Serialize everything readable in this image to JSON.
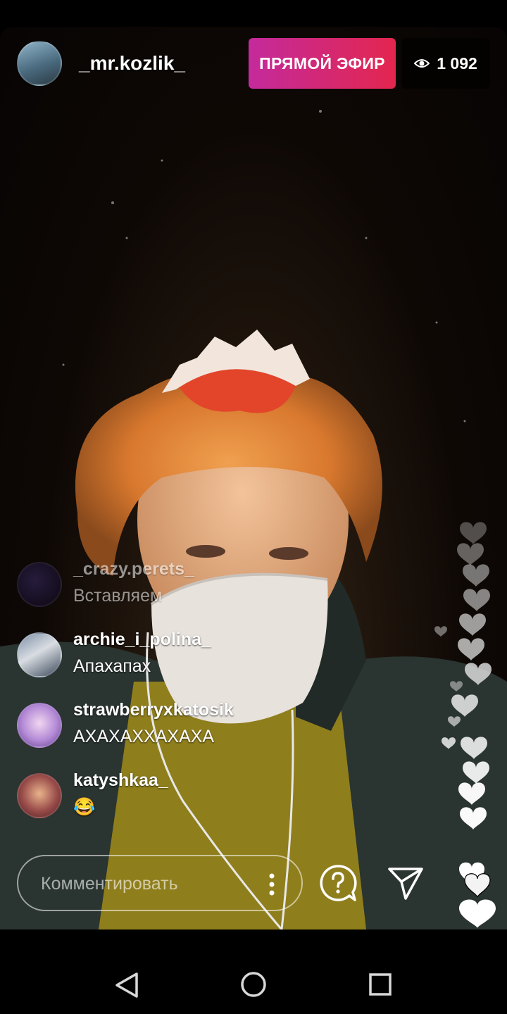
{
  "stream": {
    "host_username": "_mr.kozlik_",
    "live_label": "ПРЯМОЙ ЭФИР",
    "viewer_count": "1 092",
    "viewer_icon": "eye-icon"
  },
  "comments": [
    {
      "username": "_crazy.perets_",
      "text": "Вставляем"
    },
    {
      "username": "archie_i_polina_",
      "text": "Апахапах"
    },
    {
      "username": "strawberryxkatosik",
      "text": "АХАХАХХАХАХА"
    },
    {
      "username": "katyshkaa_",
      "text": "😂"
    }
  ],
  "composer": {
    "placeholder": "Комментировать",
    "more_icon": "vertical-dots-icon",
    "question_icon": "question-bubble-icon",
    "send_icon": "paper-plane-icon",
    "like_icon": "heart-icon"
  },
  "system_nav": [
    "back-icon",
    "home-icon",
    "recents-icon"
  ],
  "colors": {
    "live_gradient_start": "#c42a9c",
    "live_gradient_end": "#e3264e",
    "background": "#000000"
  }
}
